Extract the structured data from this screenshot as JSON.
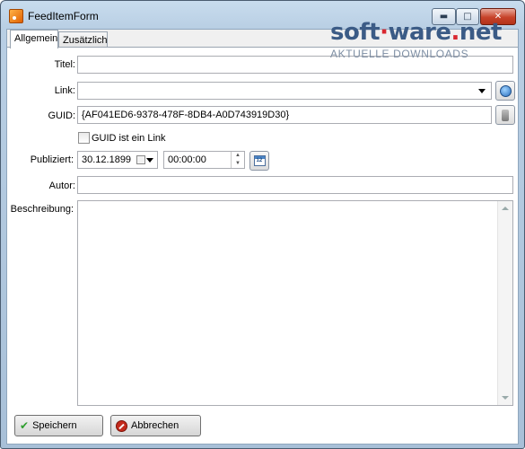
{
  "window": {
    "title": "FeedItemForm",
    "min_glyph": "▬",
    "max_glyph": "□",
    "close_glyph": "✕"
  },
  "watermark": {
    "brand_part1": "soft",
    "brand_dot": "·",
    "brand_part2": "ware",
    "brand_dot2": ".",
    "brand_part3": "net",
    "tagline": "AKTUELLE DOWNLOADS"
  },
  "tabs": [
    {
      "label": "Allgemein",
      "active": true
    },
    {
      "label": "Zusätzlich",
      "active": false
    }
  ],
  "form": {
    "title_label": "Titel:",
    "title_value": "",
    "link_label": "Link:",
    "link_value": "",
    "guid_label": "GUID:",
    "guid_value": "{AF041ED6-9378-478F-8DB4-A0D743919D30}",
    "guid_checkbox_label": "GUID ist ein Link",
    "guid_checkbox_checked": false,
    "published_label": "Publiziert:",
    "published_date": "30.12.1899",
    "published_time": "00:00:00",
    "calendar_glyph": "12",
    "author_label": "Autor:",
    "author_value": "",
    "description_label": "Beschreibung:",
    "description_value": ""
  },
  "buttons": {
    "save_label": "Speichern",
    "cancel_label": "Abbrechen"
  },
  "icons": {
    "save": "check-icon",
    "cancel": "cancel-icon",
    "link_open": "globe-icon",
    "guid_generate": "tool-icon",
    "calendar": "calendar-icon",
    "app": "rss-icon"
  },
  "colors": {
    "title_bg": "#b9cfe4",
    "watermark_blue": "#3b5b86",
    "watermark_red": "#d9282f"
  }
}
